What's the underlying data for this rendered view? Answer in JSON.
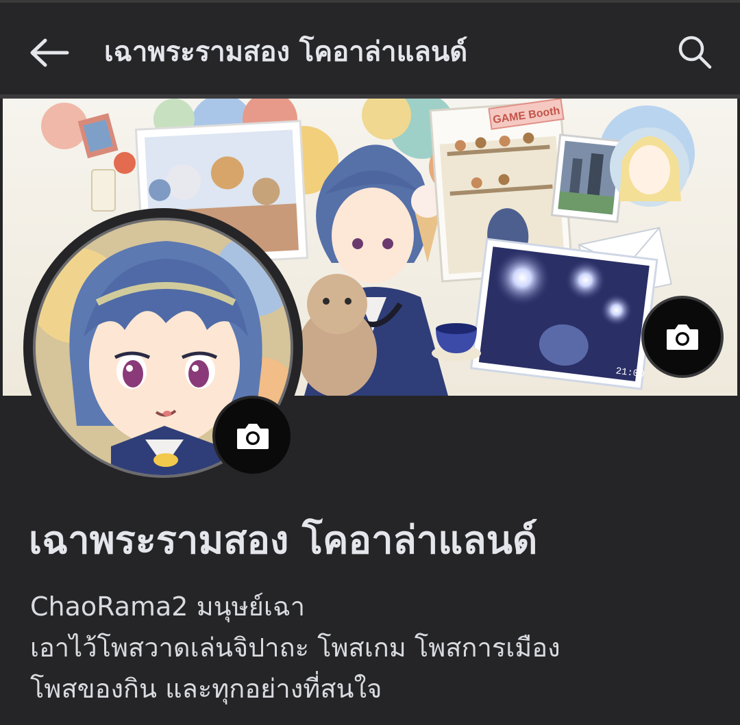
{
  "header": {
    "title": "เฉาพระรามสอง โคอาล่าแลนด์",
    "back_icon": "arrow-left-icon",
    "search_icon": "search-icon"
  },
  "cover": {
    "camera_icon": "camera-icon",
    "texts": [
      "GAME Booth",
      "21:00"
    ]
  },
  "avatar": {
    "camera_icon": "camera-icon"
  },
  "profile": {
    "name": "เฉาพระรามสอง โคอาล่าแลนด์",
    "bio_lines": [
      "ChaoRama2 มนุษย์เฉา",
      "เอาไว้โพสวาดเล่นจิปาถะ โพสเกม โพสการเมือง",
      "โพสของกิน และทุกอย่างที่สนใจ"
    ]
  },
  "colors": {
    "background": "#252527",
    "text": "#e4e6eb",
    "button": "#0a0a0a"
  }
}
